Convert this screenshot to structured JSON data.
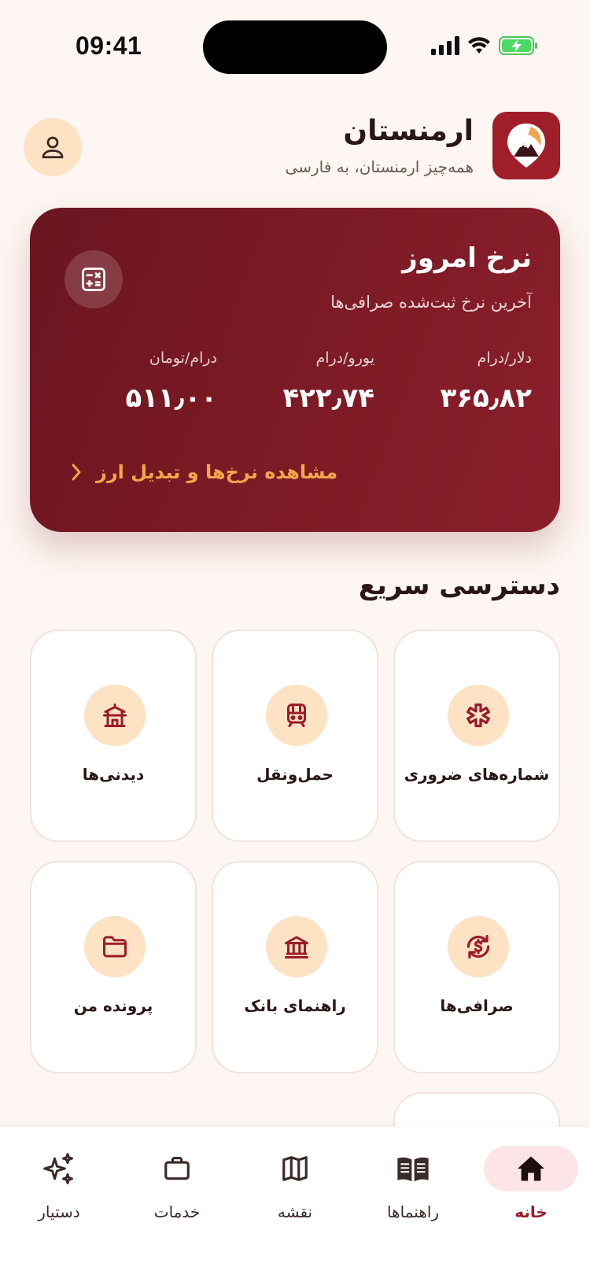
{
  "status": {
    "time": "09:41"
  },
  "header": {
    "title": "ارمنستان",
    "subtitle": "همه‌چیز ارمنستان، به فارسی"
  },
  "rates": {
    "title": "نرخ امروز",
    "subtitle": "آخرین نرخ ثبت‌شده صرافی‌ها",
    "items": [
      {
        "label": "دلار/درام",
        "value": "۳۶۵٫۸۲"
      },
      {
        "label": "یورو/درام",
        "value": "۴۲۲٫۷۴"
      },
      {
        "label": "درام/تومان",
        "value": "۵۱۱٫۰۰"
      }
    ],
    "link": "مشاهده نرخ‌ها و تبدیل ارز"
  },
  "quick": {
    "title": "دسترسی سریع",
    "tiles": [
      {
        "label": "شماره‌های ضروری",
        "icon": "asterisk-icon"
      },
      {
        "label": "حمل‌ونقل",
        "icon": "train-icon"
      },
      {
        "label": "دیدنی‌ها",
        "icon": "temple-icon"
      },
      {
        "label": "صرافی‌ها",
        "icon": "exchange-icon"
      },
      {
        "label": "راهنمای بانک",
        "icon": "bank-icon"
      },
      {
        "label": "پرونده من",
        "icon": "folder-icon"
      }
    ]
  },
  "tabs": [
    {
      "label": "خانه",
      "icon": "home-icon",
      "active": true
    },
    {
      "label": "راهنماها",
      "icon": "book-icon"
    },
    {
      "label": "نقشه",
      "icon": "map-icon"
    },
    {
      "label": "خدمات",
      "icon": "briefcase-icon"
    },
    {
      "label": "دستیار",
      "icon": "sparkles-icon"
    }
  ],
  "colors": {
    "brand": "#8b1f2c",
    "accent": "#f4a54b",
    "tint": "#fde3c4",
    "background": "#fdf6f2"
  }
}
